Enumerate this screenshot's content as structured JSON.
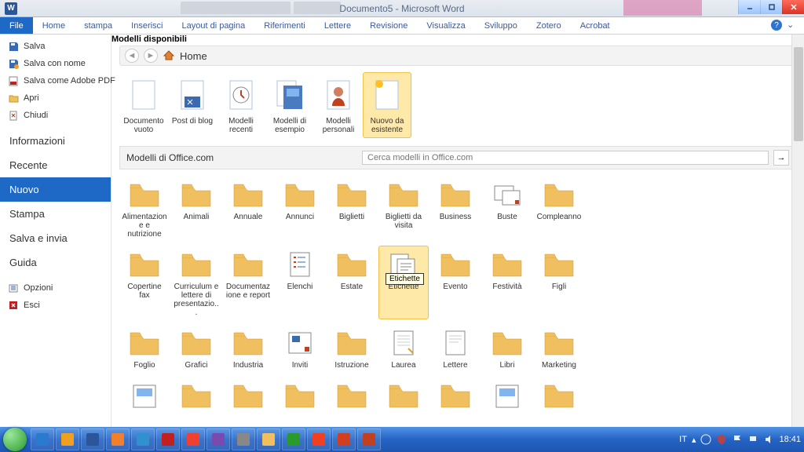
{
  "title": "Documento5 - Microsoft Word",
  "ribbon": [
    "File",
    "Home",
    "stampa",
    "Inserisci",
    "Layout di pagina",
    "Riferimenti",
    "Lettere",
    "Revisione",
    "Visualizza",
    "Sviluppo",
    "Zotero",
    "Acrobat"
  ],
  "sidebar_small": [
    {
      "icon": "save",
      "label": "Salva"
    },
    {
      "icon": "saveas",
      "label": "Salva con nome"
    },
    {
      "icon": "pdf",
      "label": "Salva come Adobe PDF"
    },
    {
      "icon": "open",
      "label": "Apri"
    },
    {
      "icon": "close",
      "label": "Chiudi"
    }
  ],
  "sidebar_big": [
    "Informazioni",
    "Recente",
    "Nuovo",
    "Stampa",
    "Salva e invia",
    "Guida"
  ],
  "sidebar_bottom": [
    {
      "icon": "options",
      "label": "Opzioni"
    },
    {
      "icon": "exit",
      "label": "Esci"
    }
  ],
  "heading": "Modelli disponibili",
  "nav_home": "Home",
  "templates": [
    {
      "name": "doc-blank",
      "label": "Documento vuoto"
    },
    {
      "name": "blog-post",
      "label": "Post di blog"
    },
    {
      "name": "recent",
      "label": "Modelli recenti"
    },
    {
      "name": "sample",
      "label": "Modelli di esempio"
    },
    {
      "name": "personal",
      "label": "Modelli personali"
    },
    {
      "name": "from-existing",
      "label": "Nuovo da esistente",
      "selected": true
    }
  ],
  "office_label": "Modelli di Office.com",
  "search_placeholder": "Cerca modelli in Office.com",
  "folders_r1": [
    "Alimentazione e nutrizione",
    "Animali",
    "Annuale",
    "Annunci",
    "Biglietti",
    "Biglietti da visita",
    "Business",
    "Buste",
    "Compleanno"
  ],
  "folders_r2": [
    "Copertine fax",
    "Curriculum e lettere di presentazio...",
    "Documentazione e report",
    "Elenchi",
    "Estate",
    "Etichette",
    "Evento",
    "Festività",
    "Figli"
  ],
  "folders_r3": [
    "Foglio",
    "Grafici",
    "Industria",
    "Inviti",
    "Istruzione",
    "Laurea",
    "Lettere",
    "Libri",
    "Marketing"
  ],
  "tooltip": "Etichette",
  "special_icons_r1": {
    "7": "envelope"
  },
  "special_icons_r2": {
    "3": "list",
    "5": "labels"
  },
  "special_icons_r3": {
    "3": "card",
    "5": "sheet",
    "6": "letter"
  },
  "tray": {
    "lang": "IT",
    "time": "18:41"
  }
}
